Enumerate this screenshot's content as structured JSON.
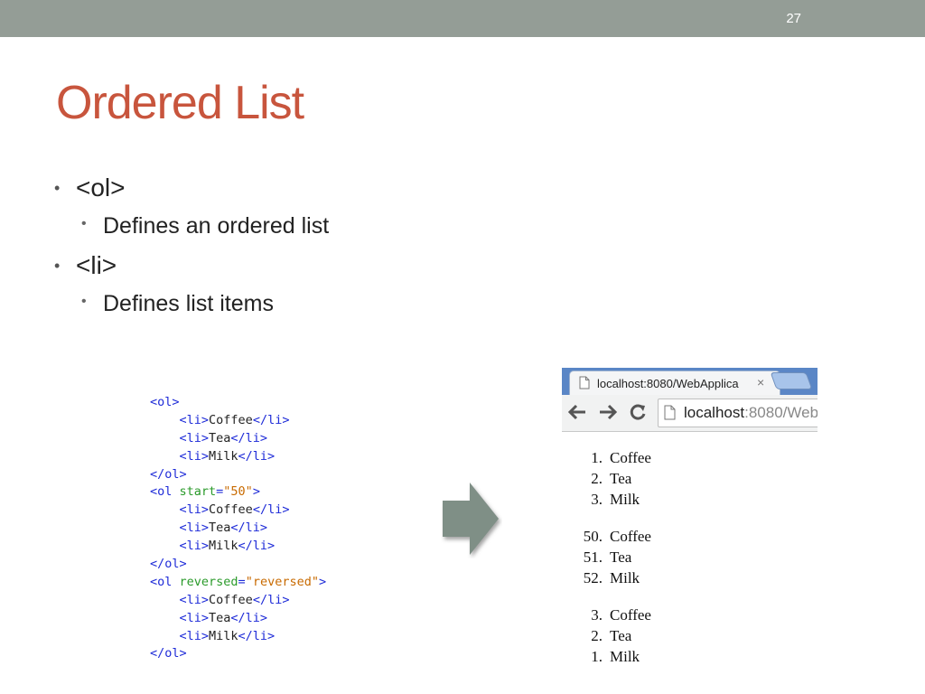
{
  "slide": {
    "number": "27",
    "title": "Ordered List",
    "bullets": [
      {
        "text": "<ol>",
        "sub": "Defines an ordered list"
      },
      {
        "text": "<li>",
        "sub": "Defines list items"
      }
    ]
  },
  "code": {
    "lines": [
      {
        "indent": "",
        "tag_open": "<ol",
        "attr": "",
        "eq": "",
        "val": "",
        "tag_close": ">",
        "text": "",
        "end_tag": ""
      },
      {
        "indent": "    ",
        "tag_open": "<li>",
        "attr": "",
        "eq": "",
        "val": "",
        "tag_close": "",
        "text": "Coffee",
        "end_tag": "</li>"
      },
      {
        "indent": "    ",
        "tag_open": "<li>",
        "attr": "",
        "eq": "",
        "val": "",
        "tag_close": "",
        "text": "Tea",
        "end_tag": "</li>"
      },
      {
        "indent": "    ",
        "tag_open": "<li>",
        "attr": "",
        "eq": "",
        "val": "",
        "tag_close": "",
        "text": "Milk",
        "end_tag": "</li>"
      },
      {
        "indent": "",
        "tag_open": "</ol>",
        "attr": "",
        "eq": "",
        "val": "",
        "tag_close": "",
        "text": "",
        "end_tag": ""
      },
      {
        "indent": "",
        "tag_open": "<ol ",
        "attr": "start",
        "eq": "=",
        "val": "\"50\"",
        "tag_close": ">",
        "text": "",
        "end_tag": ""
      },
      {
        "indent": "    ",
        "tag_open": "<li>",
        "attr": "",
        "eq": "",
        "val": "",
        "tag_close": "",
        "text": "Coffee",
        "end_tag": "</li>"
      },
      {
        "indent": "    ",
        "tag_open": "<li>",
        "attr": "",
        "eq": "",
        "val": "",
        "tag_close": "",
        "text": "Tea",
        "end_tag": "</li>"
      },
      {
        "indent": "    ",
        "tag_open": "<li>",
        "attr": "",
        "eq": "",
        "val": "",
        "tag_close": "",
        "text": "Milk",
        "end_tag": "</li>"
      },
      {
        "indent": "",
        "tag_open": "</ol>",
        "attr": "",
        "eq": "",
        "val": "",
        "tag_close": "",
        "text": "",
        "end_tag": ""
      },
      {
        "indent": "",
        "tag_open": "<ol ",
        "attr": "reversed",
        "eq": "=",
        "val": "\"reversed\"",
        "tag_close": ">",
        "text": "",
        "end_tag": ""
      },
      {
        "indent": "    ",
        "tag_open": "<li>",
        "attr": "",
        "eq": "",
        "val": "",
        "tag_close": "",
        "text": "Coffee",
        "end_tag": "</li>"
      },
      {
        "indent": "    ",
        "tag_open": "<li>",
        "attr": "",
        "eq": "",
        "val": "",
        "tag_close": "",
        "text": "Tea",
        "end_tag": "</li>"
      },
      {
        "indent": "    ",
        "tag_open": "<li>",
        "attr": "",
        "eq": "",
        "val": "",
        "tag_close": "",
        "text": "Milk",
        "end_tag": "</li>"
      },
      {
        "indent": "",
        "tag_open": "</ol>",
        "attr": "",
        "eq": "",
        "val": "",
        "tag_close": "",
        "text": "",
        "end_tag": ""
      }
    ]
  },
  "arrow": {
    "icon": "right-arrow-icon",
    "color": "#7f8f86"
  },
  "browser": {
    "tab_title": "localhost:8080/WebApplica",
    "tab_close": "×",
    "url_host": "localhost",
    "url_rest": ":8080/Web",
    "icons": {
      "back": "back-arrow-icon",
      "forward": "forward-arrow-icon",
      "reload": "reload-icon",
      "page": "page-icon"
    },
    "lists": [
      {
        "items": [
          {
            "num": "1.",
            "label": "Coffee"
          },
          {
            "num": "2.",
            "label": "Tea"
          },
          {
            "num": "3.",
            "label": "Milk"
          }
        ]
      },
      {
        "items": [
          {
            "num": "50.",
            "label": "Coffee"
          },
          {
            "num": "51.",
            "label": "Tea"
          },
          {
            "num": "52.",
            "label": "Milk"
          }
        ]
      },
      {
        "items": [
          {
            "num": "3.",
            "label": "Coffee"
          },
          {
            "num": "2.",
            "label": "Tea"
          },
          {
            "num": "1.",
            "label": "Milk"
          }
        ]
      }
    ]
  }
}
